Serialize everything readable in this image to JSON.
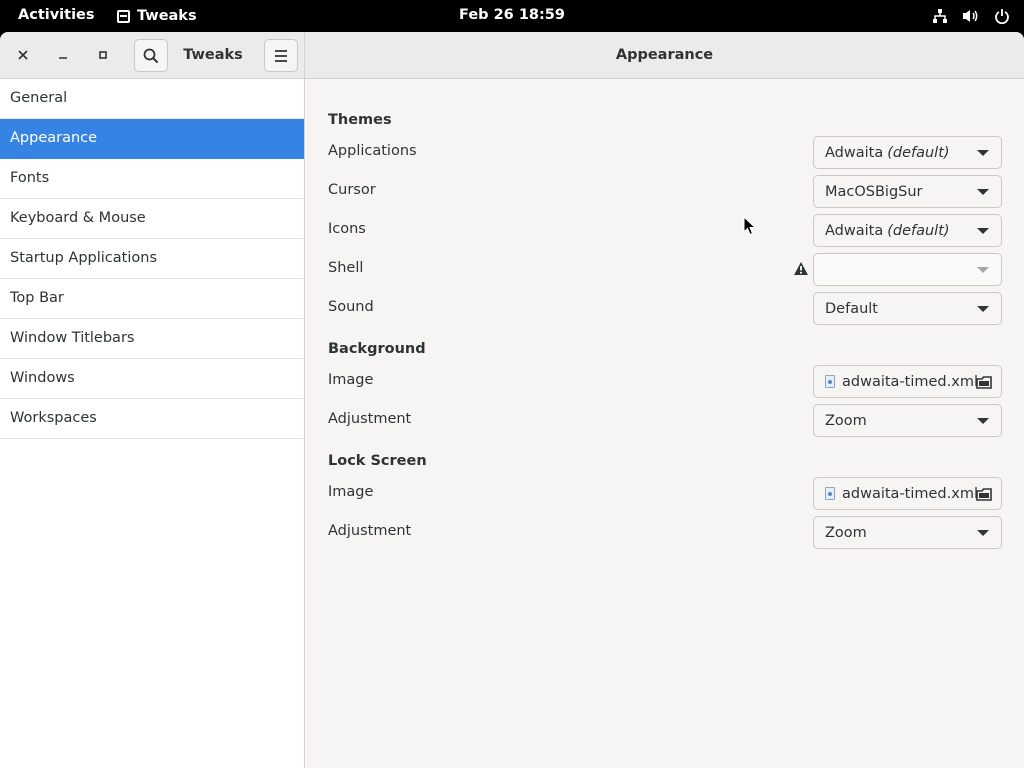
{
  "topbar": {
    "activities": "Activities",
    "app_name": "Tweaks",
    "clock": "Feb 26  18:59"
  },
  "window": {
    "sidebar_title": "Tweaks",
    "page_title": "Appearance"
  },
  "sidebar": {
    "items": [
      {
        "label": "General"
      },
      {
        "label": "Appearance"
      },
      {
        "label": "Fonts"
      },
      {
        "label": "Keyboard & Mouse"
      },
      {
        "label": "Startup Applications"
      },
      {
        "label": "Top Bar"
      },
      {
        "label": "Window Titlebars"
      },
      {
        "label": "Windows"
      },
      {
        "label": "Workspaces"
      }
    ],
    "active_index": 1
  },
  "content": {
    "themes": {
      "title": "Themes",
      "applications": {
        "label": "Applications",
        "value": "Adwaita",
        "suffix": "(default)"
      },
      "cursor": {
        "label": "Cursor",
        "value": "MacOSBigSur"
      },
      "icons": {
        "label": "Icons",
        "value": "Adwaita",
        "suffix": "(default)"
      },
      "shell": {
        "label": "Shell",
        "value": ""
      },
      "sound": {
        "label": "Sound",
        "value": "Default"
      }
    },
    "background": {
      "title": "Background",
      "image": {
        "label": "Image",
        "value": "adwaita-timed.xml"
      },
      "adjustment": {
        "label": "Adjustment",
        "value": "Zoom"
      }
    },
    "lock_screen": {
      "title": "Lock Screen",
      "image": {
        "label": "Image",
        "value": "adwaita-timed.xml"
      },
      "adjustment": {
        "label": "Adjustment",
        "value": "Zoom"
      }
    }
  },
  "colors": {
    "accent": "#3584e4",
    "window_bg": "#f6f5f4",
    "topbar_bg": "#000000"
  }
}
